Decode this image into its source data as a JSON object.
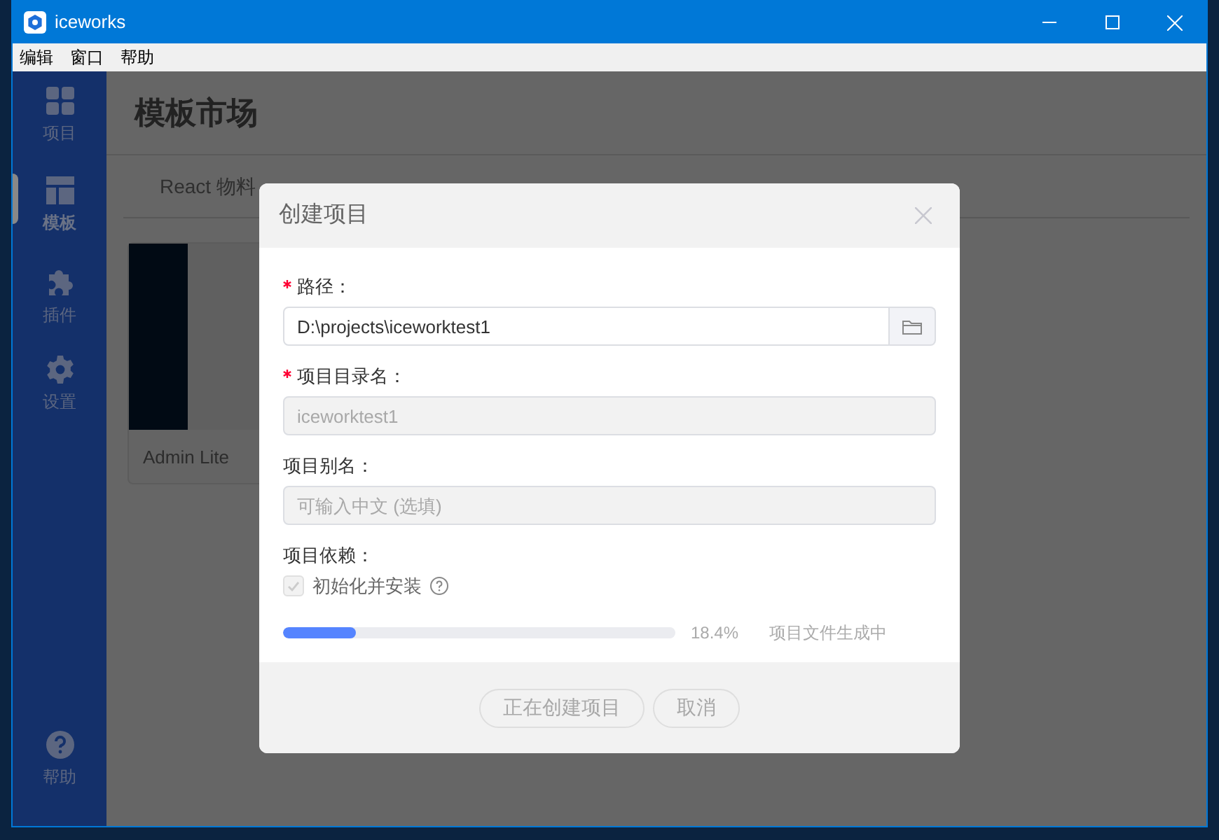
{
  "window": {
    "title": "iceworks"
  },
  "menu": [
    "编辑",
    "窗口",
    "帮助"
  ],
  "sidebar": {
    "items": [
      {
        "label": "项目",
        "kind": "grid",
        "selected": false
      },
      {
        "label": "模板",
        "kind": "layout",
        "selected": true
      },
      {
        "label": "插件",
        "kind": "puzzle",
        "selected": false
      },
      {
        "label": "设置",
        "kind": "gear",
        "selected": false
      }
    ],
    "help": {
      "label": "帮助"
    }
  },
  "page": {
    "title": "模板市场",
    "tabs": [
      {
        "label": "React 物料",
        "selected": false
      }
    ],
    "templates": [
      {
        "name": "Admin Lite"
      }
    ]
  },
  "dialog": {
    "title": "创建项目",
    "fields": [
      {
        "label": "路径：",
        "required": true,
        "value": "D:\\projects\\iceworktest1",
        "disabled": false,
        "kind": "browse"
      },
      {
        "label": "项目目录名：",
        "required": true,
        "value": "iceworktest1",
        "disabled": true,
        "kind": "text"
      },
      {
        "label": "项目别名：",
        "required": false,
        "placeholder": "可输入中文 (选填)",
        "disabled": true,
        "kind": "text"
      }
    ],
    "dependency": {
      "label": "项目依赖：",
      "checkbox": {
        "label": "初始化并安装",
        "checked": true,
        "disabled": true
      }
    },
    "progress": {
      "level": 0.184,
      "percent": "18.4%",
      "status": "项目文件生成中"
    },
    "buttons": [
      {
        "label": "正在创建项目",
        "disabled": true
      },
      {
        "label": "取消",
        "disabled": true
      }
    ]
  }
}
